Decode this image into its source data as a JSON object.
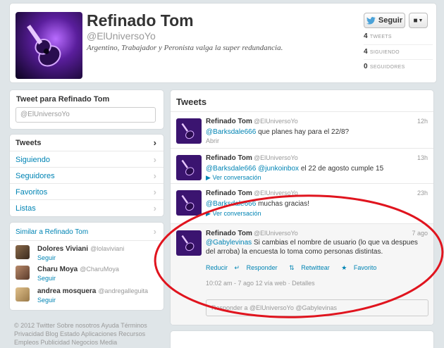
{
  "profile": {
    "name": "Refinado Tom",
    "handle": "@ElUniversoYo",
    "bio": "Argentino, Trabajador y Peronista valga la super redundancia.",
    "follow_label": "Seguir",
    "stats": [
      {
        "value": "4",
        "label": "TWEETS"
      },
      {
        "value": "4",
        "label": "SIGUIENDO"
      },
      {
        "value": "0",
        "label": "SEGUIDORES"
      }
    ]
  },
  "compose": {
    "title": "Tweet para Refinado Tom",
    "placeholder": "@ElUniversoYo"
  },
  "nav": {
    "items": [
      "Tweets",
      "Siguiendo",
      "Seguidores",
      "Favoritos",
      "Listas"
    ]
  },
  "similar": {
    "title": "Similar a Refinado Tom",
    "follow_label": "Seguir",
    "users": [
      {
        "name": "Dolores Viviani",
        "handle": "@lolaviviani"
      },
      {
        "name": "Charu Moya",
        "handle": "@CharuMoya"
      },
      {
        "name": "andrea mosquera",
        "handle": "@andregalleguita"
      }
    ]
  },
  "footer": {
    "lines": [
      "© 2012 Twitter  Sobre nosotros  Ayuda  Términos",
      "Privacidad  Blog  Estado  Aplicaciones  Recursos",
      "Empleos  Publicidad  Negocios  Media"
    ]
  },
  "timeline": {
    "title": "Tweets",
    "tweets": [
      {
        "name": "Refinado Tom",
        "handle": "@ElUniversoYo",
        "time": "12h",
        "mentions": [
          "@Barksdale666"
        ],
        "text": " que planes hay para el 22/8?",
        "sub": "Abrir"
      },
      {
        "name": "Refinado Tom",
        "handle": "@ElUniversoYo",
        "time": "13h",
        "mentions": [
          "@Barksdale666",
          "@junkoinbox"
        ],
        "text": " el 22 de agosto cumple 15",
        "sub": "Ver conversación"
      },
      {
        "name": "Refinado Tom",
        "handle": "@ElUniversoYo",
        "time": "23h",
        "mentions": [
          "@Barksdale666"
        ],
        "text": " muchas gracias!",
        "sub": "Ver conversación"
      },
      {
        "name": "Refinado Tom",
        "handle": "@ElUniversoYo",
        "time": "7 ago",
        "mentions": [
          "@Gabylevinas"
        ],
        "text": " Si cambias el nombre de usuario (lo que va despues del arroba) la encuesta lo toma como personas distintas.",
        "actions": [
          "Reducir",
          "Responder",
          "Retwittear",
          "Favorito"
        ],
        "meta": "10:02 am - 7 ago 12 vía web · Detalles",
        "reply_placeholder": "Responder a @ElUniversoYo @Gabylevinas"
      }
    ]
  },
  "colors": {
    "link": "#0084b4",
    "background": "#dfe5e8",
    "annotation": "#e0141e"
  }
}
